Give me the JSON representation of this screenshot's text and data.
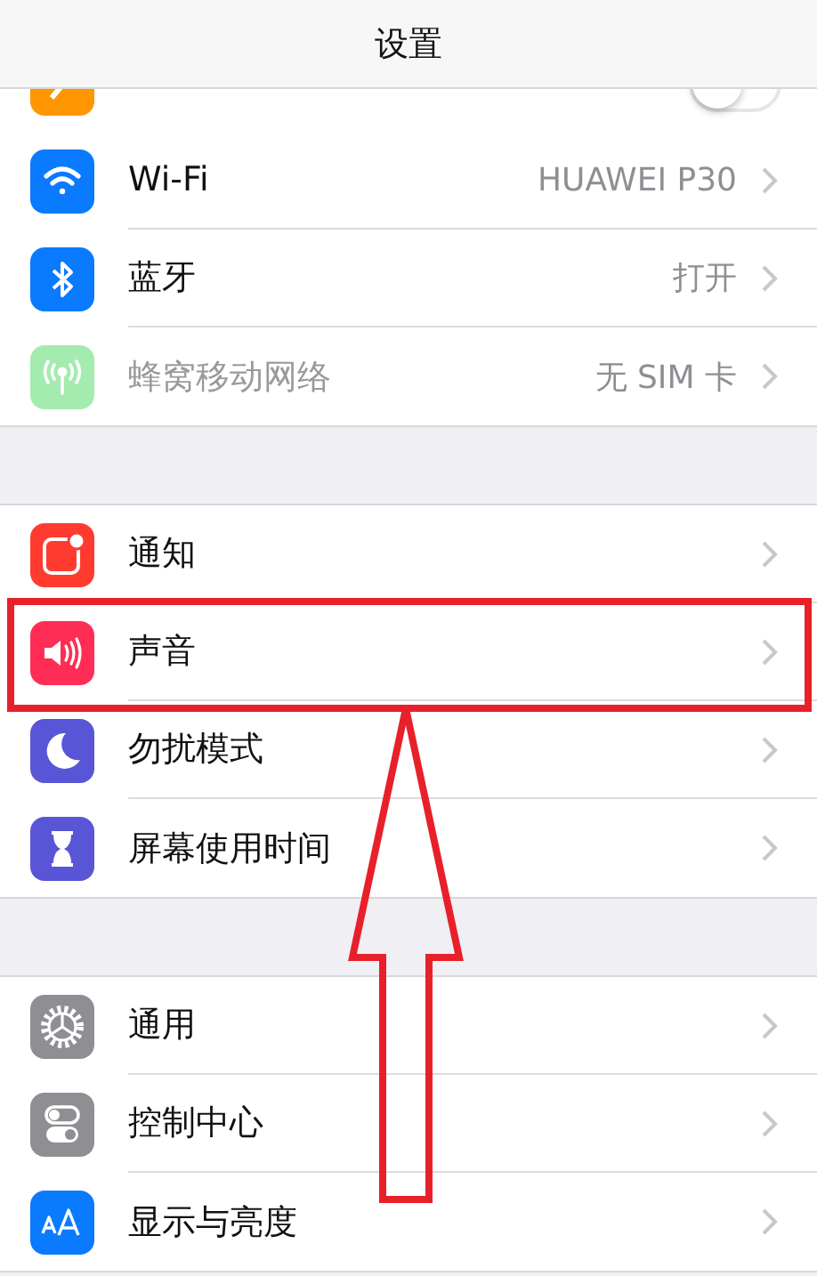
{
  "nav": {
    "title": "设置"
  },
  "groups": [
    {
      "rows": [
        {
          "kind": "toggle",
          "on": false
        },
        {
          "kind": "wifi",
          "label": "Wi-Fi",
          "value": "HUAWEI P30",
          "disabled": false,
          "highlighted": false
        },
        {
          "kind": "bluetooth",
          "label": "蓝牙",
          "value": "打开",
          "disabled": false,
          "highlighted": false
        },
        {
          "kind": "cellular",
          "label": "蜂窝移动网络",
          "value": "无 SIM 卡",
          "disabled": true,
          "highlighted": false
        }
      ]
    },
    {
      "rows": [
        {
          "kind": "notifications",
          "label": "通知",
          "disabled": false,
          "highlighted": false
        },
        {
          "kind": "sound",
          "label": "声音",
          "disabled": false,
          "highlighted": true
        },
        {
          "kind": "moon",
          "label": "勿扰模式",
          "disabled": false,
          "highlighted": false
        },
        {
          "kind": "hourglass",
          "label": "屏幕使用时间",
          "disabled": false,
          "highlighted": false
        }
      ]
    },
    {
      "rows": [
        {
          "kind": "gear",
          "label": "通用",
          "disabled": false,
          "highlighted": false
        },
        {
          "kind": "switches",
          "label": "控制中心",
          "disabled": false,
          "highlighted": false
        },
        {
          "kind": "textsize",
          "label": "显示与亮度",
          "disabled": false,
          "highlighted": false
        }
      ]
    }
  ]
}
